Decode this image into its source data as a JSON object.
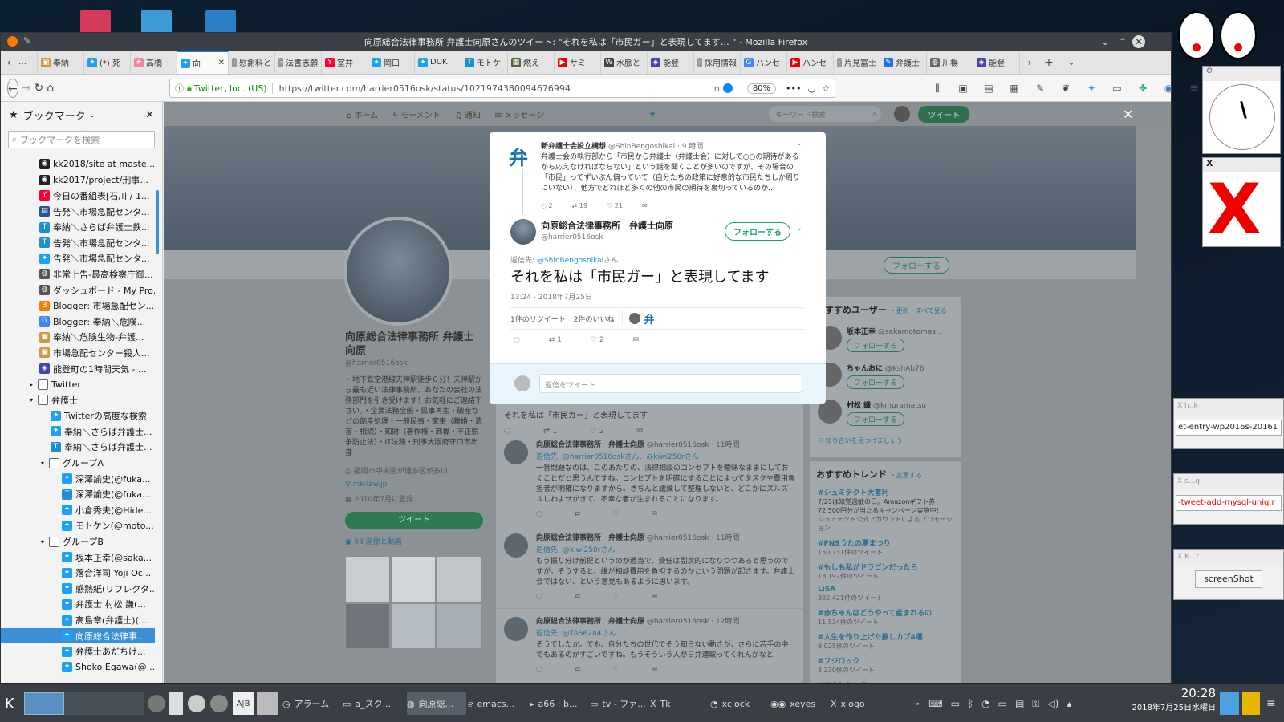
{
  "window": {
    "title": "向原総合法律事務所 弁護士向原さんのツイート: \"それを私は「市民ガー」と表現してます… \" - Mozilla Firefox"
  },
  "tabs": [
    {
      "label": "奉納",
      "icon": "bookmark-icon",
      "color": "#c94"
    },
    {
      "label": "(*) 死",
      "icon": "twitter-icon",
      "color": "#1da1f2"
    },
    {
      "label": "高橋",
      "icon": "star-icon",
      "color": "#e89"
    },
    {
      "label": "向",
      "icon": "twitter-icon",
      "color": "#1da1f2",
      "active": true
    },
    {
      "label": "慰謝料と",
      "icon": "none",
      "color": "#999"
    },
    {
      "label": "法書志願",
      "icon": "none",
      "color": "#999"
    },
    {
      "label": "室井",
      "icon": "yahoo-icon",
      "color": "#f03"
    },
    {
      "label": "岡口",
      "icon": "twitter-icon",
      "color": "#1da1f2"
    },
    {
      "label": "DUK",
      "icon": "twitter-icon",
      "color": "#1da1f2"
    },
    {
      "label": "モトケ",
      "icon": "tweetdeck-icon",
      "color": "#1d91d0"
    },
    {
      "label": "燃え",
      "icon": "image-icon",
      "color": "#564"
    },
    {
      "label": "サミ",
      "icon": "youtube-icon",
      "color": "#e00"
    },
    {
      "label": "水脈と",
      "icon": "wikipedia-icon",
      "color": "#444"
    },
    {
      "label": "能登",
      "icon": "cube-icon",
      "color": "#44a"
    },
    {
      "label": "採用情報",
      "icon": "none",
      "color": "#999"
    },
    {
      "label": "ハンセ",
      "icon": "google-icon",
      "color": "#4285f4"
    },
    {
      "label": "ハンセ",
      "icon": "youtube-icon",
      "color": "#e00"
    },
    {
      "label": "片見富士",
      "icon": "none",
      "color": "#999"
    },
    {
      "label": "弁護士",
      "icon": "edit-icon",
      "color": "#1a73e8"
    },
    {
      "label": "川楊",
      "icon": "globe-icon",
      "color": "#666"
    },
    {
      "label": "能登",
      "icon": "cube-icon",
      "color": "#44a"
    }
  ],
  "urlbar": {
    "identity": "Twitter, Inc. (US)",
    "url": "https://twitter.com/harrier0516osk/status/1021974380094676994",
    "zoom": "80%"
  },
  "sidebar": {
    "title": "ブックマーク",
    "search_placeholder": "ブックマークを検索",
    "items": [
      {
        "label": "kk2018/site at maste...",
        "icon": "github-icon",
        "indent": 0,
        "color": "#222"
      },
      {
        "label": "kk2017/project/刑事...",
        "icon": "github-icon",
        "indent": 0,
        "color": "#222"
      },
      {
        "label": "今日の番組表[石川 / 1...",
        "icon": "yahoo-icon",
        "indent": 0,
        "color": "#f03"
      },
      {
        "label": "告発＼市場急配センタ...",
        "icon": "page-icon",
        "indent": 0,
        "color": "#2a5699"
      },
      {
        "label": "奉納＼さらば弁護士鉄...",
        "icon": "tweetdeck-icon",
        "indent": 0,
        "color": "#1d91d0"
      },
      {
        "label": "告発＼市場急配センタ...",
        "icon": "tweetdeck-icon",
        "indent": 0,
        "color": "#1d91d0"
      },
      {
        "label": "告発＼市場急配センタ...",
        "icon": "twitter-icon",
        "indent": 0,
        "color": "#1da1f2"
      },
      {
        "label": "非常上告-最高検察庁御...",
        "icon": "globe-icon",
        "indent": 0,
        "color": "#555"
      },
      {
        "label": "ダッシュボード - My Pro...",
        "icon": "globe-icon",
        "indent": 0,
        "color": "#555"
      },
      {
        "label": "Blogger: 市場急配セン...",
        "icon": "blogger-icon",
        "indent": 0,
        "color": "#f57d00"
      },
      {
        "label": "Blogger: 奉納＼危険...",
        "icon": "google-icon",
        "indent": 0,
        "color": "#4285f4"
      },
      {
        "label": "奉納＼危険生物-弁護...",
        "icon": "bookmark-icon",
        "indent": 0,
        "color": "#c94"
      },
      {
        "label": "市場急配センター殺人...",
        "icon": "bookmark-icon",
        "indent": 0,
        "color": "#c94"
      },
      {
        "label": "能登町の1時間天気 - ...",
        "icon": "cube-icon",
        "indent": 0,
        "color": "#44a"
      },
      {
        "label": "Twitter",
        "icon": "folder-icon",
        "indent": 0,
        "folder": true,
        "open": false
      },
      {
        "label": "弁護士",
        "icon": "folder-icon",
        "indent": 0,
        "folder": true,
        "open": true
      },
      {
        "label": "Twitterの高度な検索",
        "icon": "twitter-icon",
        "indent": 1,
        "color": "#1da1f2"
      },
      {
        "label": "奉納＼さらば弁護士...",
        "icon": "twitter-icon",
        "indent": 1,
        "color": "#1da1f2"
      },
      {
        "label": "奉納＼さらば弁護士...",
        "icon": "tweetdeck-icon",
        "indent": 1,
        "color": "#1d91d0"
      },
      {
        "label": "グループA",
        "icon": "folder-icon",
        "indent": 1,
        "folder": true,
        "open": true
      },
      {
        "label": "深澤諭史(@fuka...",
        "icon": "twitter-icon",
        "indent": 2,
        "color": "#1da1f2"
      },
      {
        "label": "深澤諭史(@fuka...",
        "icon": "tweetdeck-icon",
        "indent": 2,
        "color": "#1d91d0"
      },
      {
        "label": "小倉秀夫(@Hide...",
        "icon": "twitter-icon",
        "indent": 2,
        "color": "#1da1f2"
      },
      {
        "label": "モトケン(@moto...",
        "icon": "twitter-icon",
        "indent": 2,
        "color": "#1da1f2"
      },
      {
        "label": "グループB",
        "icon": "folder-icon",
        "indent": 1,
        "folder": true,
        "open": true
      },
      {
        "label": "坂本正幸(@saka...",
        "icon": "twitter-icon",
        "indent": 2,
        "color": "#1da1f2"
      },
      {
        "label": "落合洋司 Yoji Oc...",
        "icon": "twitter-icon",
        "indent": 2,
        "color": "#1da1f2"
      },
      {
        "label": "感熱紙(リフレクタ...",
        "icon": "twitter-icon",
        "indent": 2,
        "color": "#1da1f2"
      },
      {
        "label": "弁護士 村松 謙(...",
        "icon": "twitter-icon",
        "indent": 2,
        "color": "#1da1f2"
      },
      {
        "label": "高島章(弁護士)(...",
        "icon": "twitter-icon",
        "indent": 2,
        "color": "#1da1f2"
      },
      {
        "label": "向原総合法律事...",
        "icon": "twitter-icon",
        "indent": 2,
        "color": "#1da1f2",
        "selected": true
      },
      {
        "label": "弁護士あだちけ...",
        "icon": "twitter-icon",
        "indent": 2,
        "color": "#1da1f2"
      },
      {
        "label": "Shoko Egawa(@...",
        "icon": "twitter-icon",
        "indent": 2,
        "color": "#1da1f2"
      }
    ]
  },
  "twitter_nav": {
    "home": "ホーム",
    "moments": "モーメント",
    "notifications": "通知",
    "messages": "メッセージ",
    "search_placeholder": "キーワード検索",
    "tweet_button": "ツイート"
  },
  "profile": {
    "name": "向原総合法律事務所 弁護士向原",
    "handle": "@harrier0516osk",
    "bio": "・地下鉄空港線天神駅徒歩０分！天神駅から最も近い法律事務所。あなたの会社の法務部門を引き受けます！お気軽にご連絡下さい。・企業法務全般・民事再生・破産などの倒産処理・一般民事・家事（離婚・遺言・相続）・知財（著作権・商標・不正競争防止法）・IT法務・刑事大阪府守口市出身",
    "location": "福岡市中央区が博多区が多い",
    "link": "mk-law.jp",
    "joined": "2010年7月に登録",
    "tweet_button": "ツイート",
    "media_label": "98 画像と動画",
    "follow_button": "フォローする"
  },
  "modal": {
    "parent_tweet": {
      "avatar_char": "弁",
      "name": "新弁護士会設立構想",
      "handle": "@ShinBengoshikai",
      "time": "· 9 時間",
      "text": "弁護士会の執行部から「市民から弁護士（弁護士会）に対して○○の期待があるから応えなければならない」という話を聞くことが多いのですが、その場合の「市民」ってずいぶん偏っていて（自分たちの政策に好意的な市民たちしか周りにいない）、他方でどれほど多くの他の市民の期待を裏切っているのか…",
      "replies": "2",
      "retweets": "19",
      "likes": "21"
    },
    "author_name": "向原総合法律事務所　弁護士向原",
    "author_handle": "@harrier0516osk",
    "follow_label": "フォローする",
    "reply_to_prefix": "返信先:",
    "reply_to_handle": "@ShinBengoshikai",
    "reply_to_suffix": "さん",
    "tweet_text": "それを私は「市民ガー」と表現してます",
    "timestamp": "13:24 - 2018年7月25日",
    "retweet_stat": "1件のリツイート",
    "like_stat": "2件のいいね",
    "liker_char": "弁",
    "action_retweets": "1",
    "action_likes": "2",
    "reply_placeholder": "返信をツイート"
  },
  "timeline": [
    {
      "name": "向原総合法律事務所　弁護士向原",
      "handle": "@harrier0516osk · 11時間",
      "reply": "返信先: @harrier0516oskさん、@kiwi250rさん",
      "text": "一番問題なのは、このあたりの、法律相談のコンセプトを曖昧なままにしておくことだと思うんですね。コンセプトを明確にすることによってタスクや費用負担者が明確になりますから。きちんと議論して整理しないと、どこかにズルズルしわよせがきて、不幸な者が生まれることになります。"
    },
    {
      "name": "向原総合法律事務所　弁護士向原",
      "handle": "@harrier0516osk · 11時間",
      "reply": "返信先: @kiwi250rさん",
      "text": "もう振り分け前提というのが過当で、受任は副次的になりつつあると思うのですが。そうすると、誰が相談費用を負担するのかという問題が起きます。弁護士会ではない、という意見もあるように思います。"
    },
    {
      "name": "向原総合法律事務所　弁護士向原",
      "handle": "@harrier0516osk · 12時間",
      "reply": "返信先: @TAS6284さん",
      "text": "そうでしたか。でも、自分たちの世代でそう知らない動きが、さらに若手の中でもあるのがすごいですね。もうそういう人が日弁連取ってくれんかなと"
    }
  ],
  "under_modal_text": "それを私は「市民ガー」と表現してます",
  "recommend": {
    "title": "おすすめユーザー",
    "links": "・更新・すべて見る",
    "users": [
      {
        "name": "坂本正幸",
        "handle": "@sakamotomas..."
      },
      {
        "name": "ちゃんおに",
        "handle": "@KshAb76"
      },
      {
        "name": "村松 謙",
        "handle": "@kmuramatsu"
      }
    ],
    "follow": "フォローする",
    "find": "知り合いを見つけましょう"
  },
  "trends": {
    "title": "おすすめトレンド",
    "change": "・変更する",
    "items": [
      {
        "tag": "#シュミテクト大喜利",
        "desc": "7/25は知覚過敏の日。Amazonギフト券72,500円分が当たるキャンペーン実施中！",
        "sub": "シュミテクト公式アカウントによるプロモーション"
      },
      {
        "tag": "#FNSうたの夏まつり",
        "desc": "",
        "sub": "150,731件のツイート"
      },
      {
        "tag": "#もしも私がドラゴンだったら",
        "desc": "",
        "sub": "18,192件のツイート"
      },
      {
        "tag": "LiSA",
        "desc": "",
        "sub": "382,421件のツイート"
      },
      {
        "tag": "#赤ちゃんはどうやって産まれるの",
        "desc": "",
        "sub": "11,534件のツイート"
      },
      {
        "tag": "#人生を作り上げた推しカプ4選",
        "desc": "",
        "sub": "9,025件のツイート"
      },
      {
        "tag": "#フジロック",
        "desc": "",
        "sub": "3,230件のツイート"
      },
      {
        "tag": "#コネヒトーク",
        "desc": "",
        "sub": ""
      }
    ]
  },
  "widgets": {
    "entry1": "et-entry-wp2016s-20161",
    "entry2": "-tweet-add-mysql-uniq.r",
    "shot_button": "screenShot",
    "t1": "h..k",
    "t2": "s...q",
    "t3": "K...t"
  },
  "taskbar": {
    "items": [
      {
        "label": "アラーム",
        "icon": "alarm-icon"
      },
      {
        "label": "a_スク...",
        "icon": "folder-icon"
      },
      {
        "label": "向原総...",
        "icon": "firefox-icon"
      },
      {
        "label": "emacs...",
        "icon": "emacs-icon"
      },
      {
        "label": "a66 : b...",
        "icon": "terminal-icon"
      },
      {
        "label": "tv - ファ...",
        "icon": "tv-icon"
      },
      {
        "label": "Tk",
        "icon": "x-icon"
      },
      {
        "label": "xclock",
        "icon": "clock-icon"
      },
      {
        "label": "xeyes",
        "icon": "eyes-icon"
      },
      {
        "label": "xlogo",
        "icon": "x-icon"
      }
    ],
    "time": "20:28",
    "date": "2018年7月25日水曜日"
  }
}
